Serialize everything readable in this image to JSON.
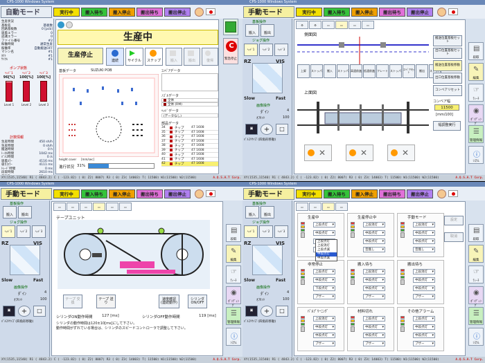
{
  "app": {
    "window_title": "CPS-1000 Windows System",
    "logo": "A.Q.S.A.T Corp."
  },
  "status_labels": {
    "run": "実行中",
    "wait": "搬入待ち",
    "stop": "搬入停止",
    "out": "搬出待ち",
    "fault": "搬出停止"
  },
  "status_colors": {
    "run": "#f4e000",
    "wait": "#35c33a",
    "stop": "#f0a000",
    "out": "#e070d8",
    "fault": "#b080f0"
  },
  "statusbar_text": "XY(1535,11540) R1 ( 4843.2) C ( -123.82) ( 0) Z2( 8007) R3 ( 0) Z3( 14003) T( 11500) W1(11500) W2(11500)",
  "q1": {
    "mode": "自動モード",
    "production_status": "生産中",
    "stop_button": "生産停止",
    "buttons": {
      "continuous": "連続",
      "cycle": "サイクル",
      "step": "ステップ",
      "carry_in": "搬入",
      "carry_out": "搬出",
      "restore": "復帰"
    },
    "emergency": "C",
    "emergency_label": "緊急停止",
    "left_info": [
      {
        "k": "生産状況",
        "v": ""
      },
      {
        "k": "基板名",
        "v": "基板数"
      },
      {
        "k": "回路基板数",
        "v": "0 [pcb]"
      },
      {
        "k": "吸着エラー",
        "v": "0"
      },
      {
        "k": "認識エラー",
        "v": "0"
      },
      {
        "k": "ファイル番号",
        "v": "#2"
      },
      {
        "k": "稼働時間",
        "v": "通常生産"
      },
      {
        "k": "稼働率",
        "v": "自動搬送OFF"
      },
      {
        "k": "マシン名",
        "v": "#1"
      },
      {
        "k": "ﾀｸﾄ",
        "v": "#1"
      },
      {
        "k": "ｻｲｸﾙ",
        "v": "#1"
      }
    ],
    "pump_label": "ポンプ状態",
    "gauges": [
      {
        "label": "ﾍｯﾄﾞ1",
        "pct": 96,
        "unit": "[%]"
      },
      {
        "label": "ﾍｯﾄﾞ2",
        "pct": 100,
        "unit": "[%]"
      },
      {
        "label": "ﾍｯﾄﾞ3",
        "pct": 100,
        "unit": "[%]"
      }
    ],
    "gauge_levels": [
      "Level 1",
      "Level 2",
      "Level 3"
    ],
    "counter_label": "計数情報",
    "counters": [
      {
        "k": "生産時間",
        "v": "450 sh/h"
      },
      {
        "k": "生産時間",
        "v": "0 sh/h"
      },
      {
        "k": "搬送時間",
        "v": "0 h"
      },
      {
        "k": "ﾄｰﾀﾙ時間",
        "v": "1042 ms"
      },
      {
        "k": "ﾊﾟﾙｽ時間",
        "v": "0 /s"
      },
      {
        "k": "吸着ｴﾗｰ",
        "v": "4116 ms"
      },
      {
        "k": "吸引ｴﾗｰ",
        "v": "4111 ms"
      },
      {
        "k": "ﾄﾚｰﾄﾞ時間",
        "v": "0 ms"
      },
      {
        "k": "段取時間",
        "v": "2610 ms"
      },
      {
        "k": "基板数",
        "v": "27 sheet"
      },
      {
        "k": "生産基板",
        "v": "27 sheet"
      }
    ],
    "board_title": "基板データ",
    "board_name": "SUZUKI POB",
    "data_title": "ｺﾝﾍﾟｱデータ",
    "nozzle_title": "ﾉｽﾞﾙデータ",
    "nozzle_rows": [
      "全体",
      "全体 (RM)"
    ],
    "head_title": "ﾍｯﾄﾞデータ",
    "head_rows": [
      "(データなし)"
    ],
    "parts_title": "部品データ",
    "parts_rows": [
      {
        "n": "34",
        "t": "チップ",
        "r": "47 1608"
      },
      {
        "n": "35",
        "t": "チップ",
        "r": "47 1608"
      },
      {
        "n": "36",
        "t": "チップ",
        "r": "47 1608"
      },
      {
        "n": "37",
        "t": "チップ",
        "r": "47 1608"
      },
      {
        "n": "38",
        "t": "チップ",
        "r": "47 1608"
      },
      {
        "n": "39",
        "t": "チップ",
        "r": "47 1608"
      },
      {
        "n": "40",
        "t": "チップ",
        "r": "47 1608"
      },
      {
        "n": "41",
        "t": "チップ",
        "r": "47 1608"
      },
      {
        "n": "42",
        "t": "チップ",
        "r": "47 1608"
      }
    ],
    "progress_label": "進行状況",
    "progress_pct": 31,
    "progress_text": "31%",
    "height_label": "height cover",
    "height_value": "[mm/sec]"
  },
  "common_left": {
    "base_ops": "基板操作",
    "carry_in": "搬入",
    "carry_out": "搬出",
    "jog_ops": "ジョグ操作",
    "heads": [
      "ﾍｯﾄﾞ1",
      "ﾍｯﾄﾞ2",
      "ﾍｯﾄﾞ3"
    ],
    "rz": "RZ",
    "vis": "VIS",
    "slow": "Slow",
    "fast": "Fast",
    "image_ops": "画像操作",
    "jog_type": "ﾀﾞｲﾝ",
    "jog_type_val": "4",
    "offset": "ｵﾌｾｯﾄ",
    "offset_val": "100",
    "pulse_label": "ﾊﾟﾙｽﾘｻｲｽﾞ(四角形移動)"
  },
  "right_strip": {
    "items": [
      "段取",
      "編集",
      "ﾃｨｰﾁ",
      "ﾎﾟﾝﾃﾞｨﾝｸﾞ",
      "管理情報",
      "ｼｽﾃﾑ"
    ]
  },
  "q2": {
    "mode": "手動モード",
    "diagram_label": "側面図",
    "top_label": "上面図",
    "btn_row": [
      "上昇",
      "ストッパ",
      "搬入",
      "ストッパ",
      "高速前進",
      "低速前進",
      "フレート",
      "ストッパ",
      "ｺﾝﾍﾞｱﾘｾｯﾄ",
      "搬出",
      "ストッパ"
    ],
    "side_buttons": [
      "搬送位置基板セット",
      "出口位置基板セット",
      "搬送位置基板移動",
      "出口位置基板移動",
      "コンベアリセット"
    ],
    "conveyor_label": "コンベア幅",
    "conveyor_value": "11500",
    "conveyor_unit": "[mm/100]",
    "width_exec": "幅調整実行"
  },
  "q3": {
    "mode": "手動モード",
    "unit_label": "テープユニット",
    "btn_tape": "テープ\n交換",
    "btn_tape2": "テープ\n送り",
    "btn_speed": "速度確認\n(連続動作)",
    "btn_cyl": "シリンダ\nON/OFF",
    "on_time_label": "シリンダON動作時間",
    "on_time": "127 [ms]",
    "off_time_label": "シリンダOFF動作時間",
    "off_time": "119 [ms]",
    "note": "シリンダの動作時間は120±10[ms]にして下さい。\n動作時間がずれている場合は、シリンダのスピードコントローラで調整して下さい。"
  },
  "q4": {
    "mode": "手動モード",
    "groups": [
      {
        "title": "生産中",
        "items": [
          "上段点灯",
          "中段点灯",
          "中段点灯",
          "音無し"
        ]
      },
      {
        "title": "生産停止中",
        "items": [
          "上段消灯",
          "中段点灯",
          "中段点灯",
          "音無し"
        ]
      },
      {
        "title": "手動モード",
        "items": [
          "上段消灯",
          "中段点灯",
          "中段点灯",
          "音無し"
        ]
      },
      {
        "title": "非常停止",
        "items": [
          "上段点灯",
          "中段点灯",
          "下段点灯",
          "ブザー"
        ]
      },
      {
        "title": "搬入待ち",
        "items": [
          "上段消灯",
          "中段点灯",
          "中段点灯",
          "ブザー"
        ]
      },
      {
        "title": "搬出待ち",
        "items": [
          "上段消灯",
          "中段点灯",
          "中段点灯",
          "ブザー"
        ]
      },
      {
        "title": "ﾊﾟﾙﾌﾟﾘｰﾆﾝｸﾞ",
        "items": [
          "上段消灯",
          "中段点灯",
          "中段点灯",
          "ブザー"
        ]
      },
      {
        "title": "材料切れ",
        "items": [
          "上段点灯",
          "中段点灯",
          "中段点灯",
          "ブザー"
        ]
      },
      {
        "title": "その他アラーム",
        "items": [
          "上段点灯",
          "中段点灯",
          "中段点灯",
          "ブザー"
        ]
      }
    ],
    "dropdown_open": [
      "上段点灯",
      "上段消灯",
      "上段点滅",
      "中段点灯",
      "中段点滅"
    ],
    "set_button": "設定",
    "cancel_button": "取消"
  }
}
